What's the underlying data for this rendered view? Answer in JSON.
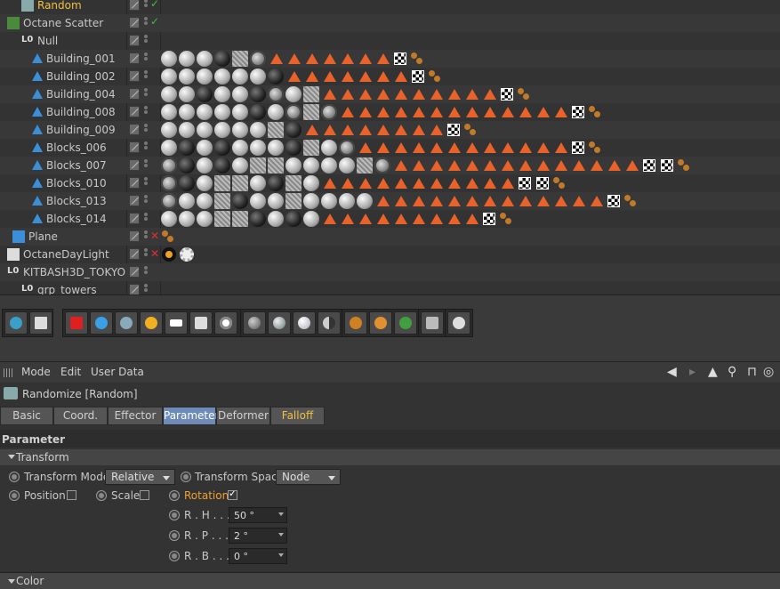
{
  "objects": [
    {
      "name": "Random",
      "selected": true,
      "check": "green",
      "icon": "random-icon",
      "tags": []
    },
    {
      "name": "Octane Scatter",
      "check": "green",
      "icon": "scatter-icon",
      "tags": []
    },
    {
      "name": "Null",
      "icon": "null-icon",
      "tags": []
    },
    {
      "name": "Building_001",
      "icon": "polygon-icon",
      "tags": {
        "mats": [
          "s",
          "s",
          "s",
          "d",
          "p",
          "m"
        ],
        "tris": 7
      }
    },
    {
      "name": "Building_002",
      "icon": "polygon-icon",
      "tags": {
        "mats": [
          "s",
          "s",
          "s",
          "s",
          "s",
          "s",
          "d"
        ],
        "tris": 7
      }
    },
    {
      "name": "Building_004",
      "icon": "polygon-icon",
      "tags": {
        "mats": [
          "s",
          "s",
          "d",
          "s",
          "s",
          "d",
          "m",
          "s",
          "p"
        ],
        "tris": 10
      }
    },
    {
      "name": "Building_008",
      "icon": "polygon-icon",
      "tags": {
        "mats": [
          "s",
          "s",
          "s",
          "s",
          "s",
          "d",
          "s",
          "m",
          "p",
          "m"
        ],
        "tris": 13
      }
    },
    {
      "name": "Building_009",
      "icon": "polygon-icon",
      "tags": {
        "mats": [
          "s",
          "s",
          "s",
          "s",
          "s",
          "s",
          "p",
          "d"
        ],
        "tris": 8
      }
    },
    {
      "name": "Blocks_006",
      "icon": "polygon-icon",
      "tags": {
        "mats": [
          "s",
          "d",
          "s",
          "d",
          "s",
          "s",
          "s",
          "d",
          "p",
          "s",
          "m"
        ],
        "tris": 12
      }
    },
    {
      "name": "Blocks_007",
      "icon": "polygon-icon",
      "tags": {
        "mats": [
          "m",
          "d",
          "s",
          "d",
          "s",
          "p",
          "p",
          "s",
          "s",
          "s",
          "s",
          "p",
          "m"
        ],
        "tris": 14
      }
    },
    {
      "name": "Blocks_010",
      "icon": "polygon-icon",
      "tags": {
        "mats": [
          "m",
          "d",
          "s",
          "p",
          "p",
          "s",
          "d",
          "p",
          "s"
        ],
        "tris": 11
      }
    },
    {
      "name": "Blocks_013",
      "icon": "polygon-icon",
      "tags": {
        "mats": [
          "m",
          "s",
          "s",
          "p",
          "d",
          "s",
          "s",
          "p",
          "s",
          "s",
          "s",
          "s"
        ],
        "tris": 13
      }
    },
    {
      "name": "Blocks_014",
      "icon": "polygon-icon",
      "tags": {
        "mats": [
          "s",
          "s",
          "s",
          "p",
          "p",
          "d",
          "s",
          "d",
          "s"
        ],
        "tris": 9
      }
    },
    {
      "name": "Plane",
      "check": "red",
      "icon": "plane-icon",
      "tags": {
        "blb": true
      }
    },
    {
      "name": "OctaneDayLight",
      "check": "red",
      "icon": "daylight-icon",
      "tags": {
        "sun": true
      }
    },
    {
      "name": "KITBASH3D_TOKYO",
      "icon": "null-icon",
      "tags": []
    },
    {
      "name": "grp_towers",
      "icon": "null-icon",
      "tags": []
    }
  ],
  "menu": {
    "mode": "Mode",
    "edit": "Edit",
    "userdata": "User Data"
  },
  "object_title": "Randomize [Random]",
  "tabs": [
    "Basic",
    "Coord.",
    "Effector",
    "Parameter",
    "Deformer",
    "Falloff"
  ],
  "active_tab": "Parameter",
  "parameter_title": "Parameter",
  "group_transform": "Transform",
  "transform_mode_label": "Transform Mode",
  "transform_mode_value": "Relative",
  "transform_space_label": "Transform Space",
  "transform_space_value": "Node",
  "position_label": "Position",
  "scale_label": "Scale",
  "rotation_label": "Rotation",
  "rh_label": "R . H . . .",
  "rh_value": "50 °",
  "rp_label": "R . P . . .",
  "rp_value": "2 °",
  "rb_label": "R . B . . .",
  "rb_value": "0 °",
  "group_color": "Color"
}
